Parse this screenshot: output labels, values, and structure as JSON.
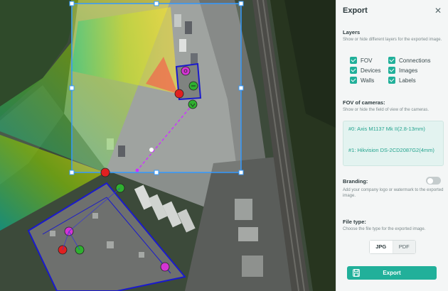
{
  "panel": {
    "title": "Export",
    "close_icon": "close-icon",
    "layers": {
      "title": "Layers",
      "description": "Show or hide different layers for the exported image.",
      "items": [
        {
          "label": "FOV",
          "checked": true
        },
        {
          "label": "Connections",
          "checked": true
        },
        {
          "label": "Devices",
          "checked": true
        },
        {
          "label": "Images",
          "checked": true
        },
        {
          "label": "Walls",
          "checked": true
        },
        {
          "label": "Labels",
          "checked": true
        }
      ]
    },
    "fov": {
      "title": "FOV of cameras:",
      "description": "Show or hide the field of view of the cameras.",
      "cameras": [
        "#0: Axis M1137 Mk II(2.8-13mm)",
        "#1: Hikvision DS-2CD2087G2(4mm)"
      ]
    },
    "branding": {
      "title": "Branding:",
      "description": "Add your company logo or watermark to the exported image.",
      "enabled": false
    },
    "file_type": {
      "title": "File type:",
      "description": "Choose the file type for the exported image.",
      "options": [
        "JPG",
        "PDF"
      ],
      "selected": "JPG"
    },
    "export_button": "Export"
  },
  "colors": {
    "accent": "#21b09a",
    "selection": "#3399ff",
    "walls": "#1a1acc",
    "connection": "#cc33ff"
  }
}
